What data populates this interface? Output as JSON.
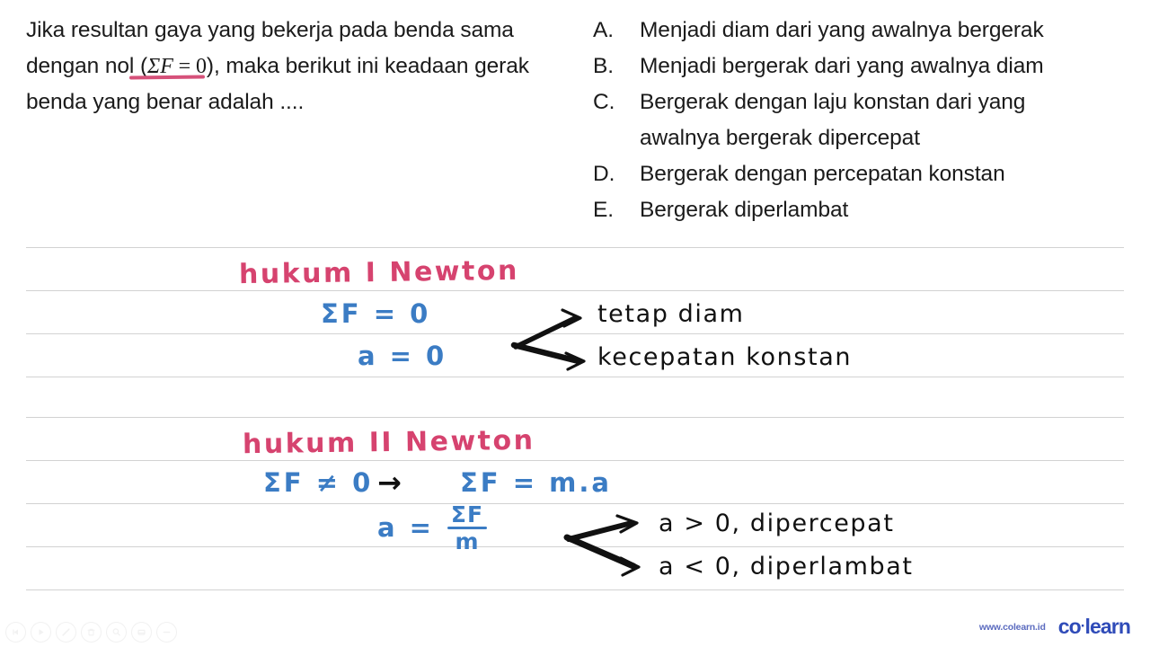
{
  "question": {
    "stem_part1": "Jika resultan gaya yang bekerja pada benda sama dengan nol (",
    "stem_math_sigma": "Σ",
    "stem_math_f": "F",
    "stem_math_eq": " = ",
    "stem_math_zero": "0",
    "stem_part2": "), maka berikut ini keadaan gerak benda yang benar adalah ....",
    "options": [
      {
        "letter": "A.",
        "text": "Menjadi diam dari yang awalnya bergerak",
        "text2": ""
      },
      {
        "letter": "B.",
        "text": "Menjadi bergerak  dari yang awalnya diam",
        "text2": ""
      },
      {
        "letter": "C.",
        "text": "Bergerak dengan laju konstan dari yang",
        "text2": "awalnya bergerak dipercepat"
      },
      {
        "letter": "D.",
        "text": "Bergerak dengan percepatan konstan",
        "text2": ""
      },
      {
        "letter": "E.",
        "text": "Bergerak diperlambat",
        "text2": ""
      }
    ]
  },
  "notes": {
    "law1": {
      "title": "hukum I Newton",
      "eq1": "ΣF = 0",
      "eq2": "a = 0",
      "result1": "tetap diam",
      "result2": "kecepatan konstan",
      "arrow_head": "›"
    },
    "law2": {
      "title": "hukum II Newton",
      "eq1_left": "ΣF ≠ 0",
      "eq1_arrow": "→",
      "eq1_right": "ΣF = m.a",
      "eq2_lhs": "a =",
      "eq2_numerator": "ΣF",
      "eq2_denominator": "m",
      "result1": "a > 0,  dipercepat",
      "result2": "a < 0,  diperlambat",
      "arrow_head": "›"
    }
  },
  "colors": {
    "pink": "#d6436f",
    "blue": "#3b7cc4",
    "ink": "#111111",
    "rule": "#d2d2d2",
    "brand": "#2f4bb8"
  },
  "footer": {
    "brand_url": "www.colearn.id",
    "brand_name_first": "co",
    "brand_name_dot": "·",
    "brand_name_second": "learn",
    "tools": [
      {
        "name": "rewind-icon"
      },
      {
        "name": "play-icon"
      },
      {
        "name": "pen-icon"
      },
      {
        "name": "trash-icon"
      },
      {
        "name": "zoom-icon"
      },
      {
        "name": "eraser-icon"
      },
      {
        "name": "minus-icon"
      }
    ]
  }
}
